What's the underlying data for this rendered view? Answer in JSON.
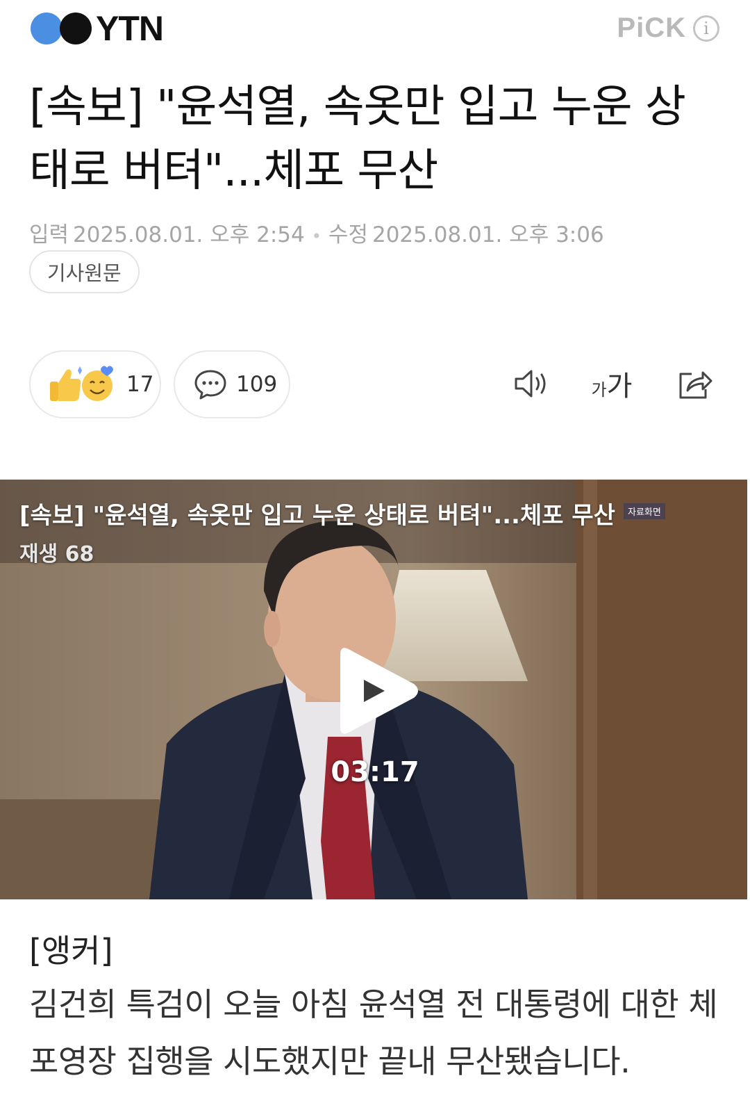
{
  "header": {
    "logo_text": "YTN",
    "pick_label": "PiCK",
    "info_symbol": "i"
  },
  "article": {
    "title": "[속보] \"윤석열, 속옷만 입고 누운 상태로 버텨\"...체포 무산",
    "published_label": "입력",
    "published": "2025.08.01. 오후 2:54",
    "modified_label": "수정",
    "modified": "2025.08.01. 오후 3:06",
    "separator": "•",
    "original_button": "기사원문",
    "anchor_label": "[앵커]",
    "body": "김건희 특검이 오늘 아침 윤석열 전 대통령에 대한 체포영장 집행을 시도했지만 끝내 무산됐습니다."
  },
  "actions": {
    "reactions_count": "17",
    "comments_count": "109",
    "font_small": "가",
    "font_large": "가"
  },
  "video": {
    "title": "[속보] \"윤석열, 속옷만 입고 누운 상태로 버텨\"...체포 무산",
    "badge": "자료화면",
    "plays": "재생 68",
    "duration": "03:17"
  },
  "colors": {
    "logo_blue": "#4a8fe2",
    "logo_black": "#111111",
    "meta_gray": "#a5a5a5"
  }
}
